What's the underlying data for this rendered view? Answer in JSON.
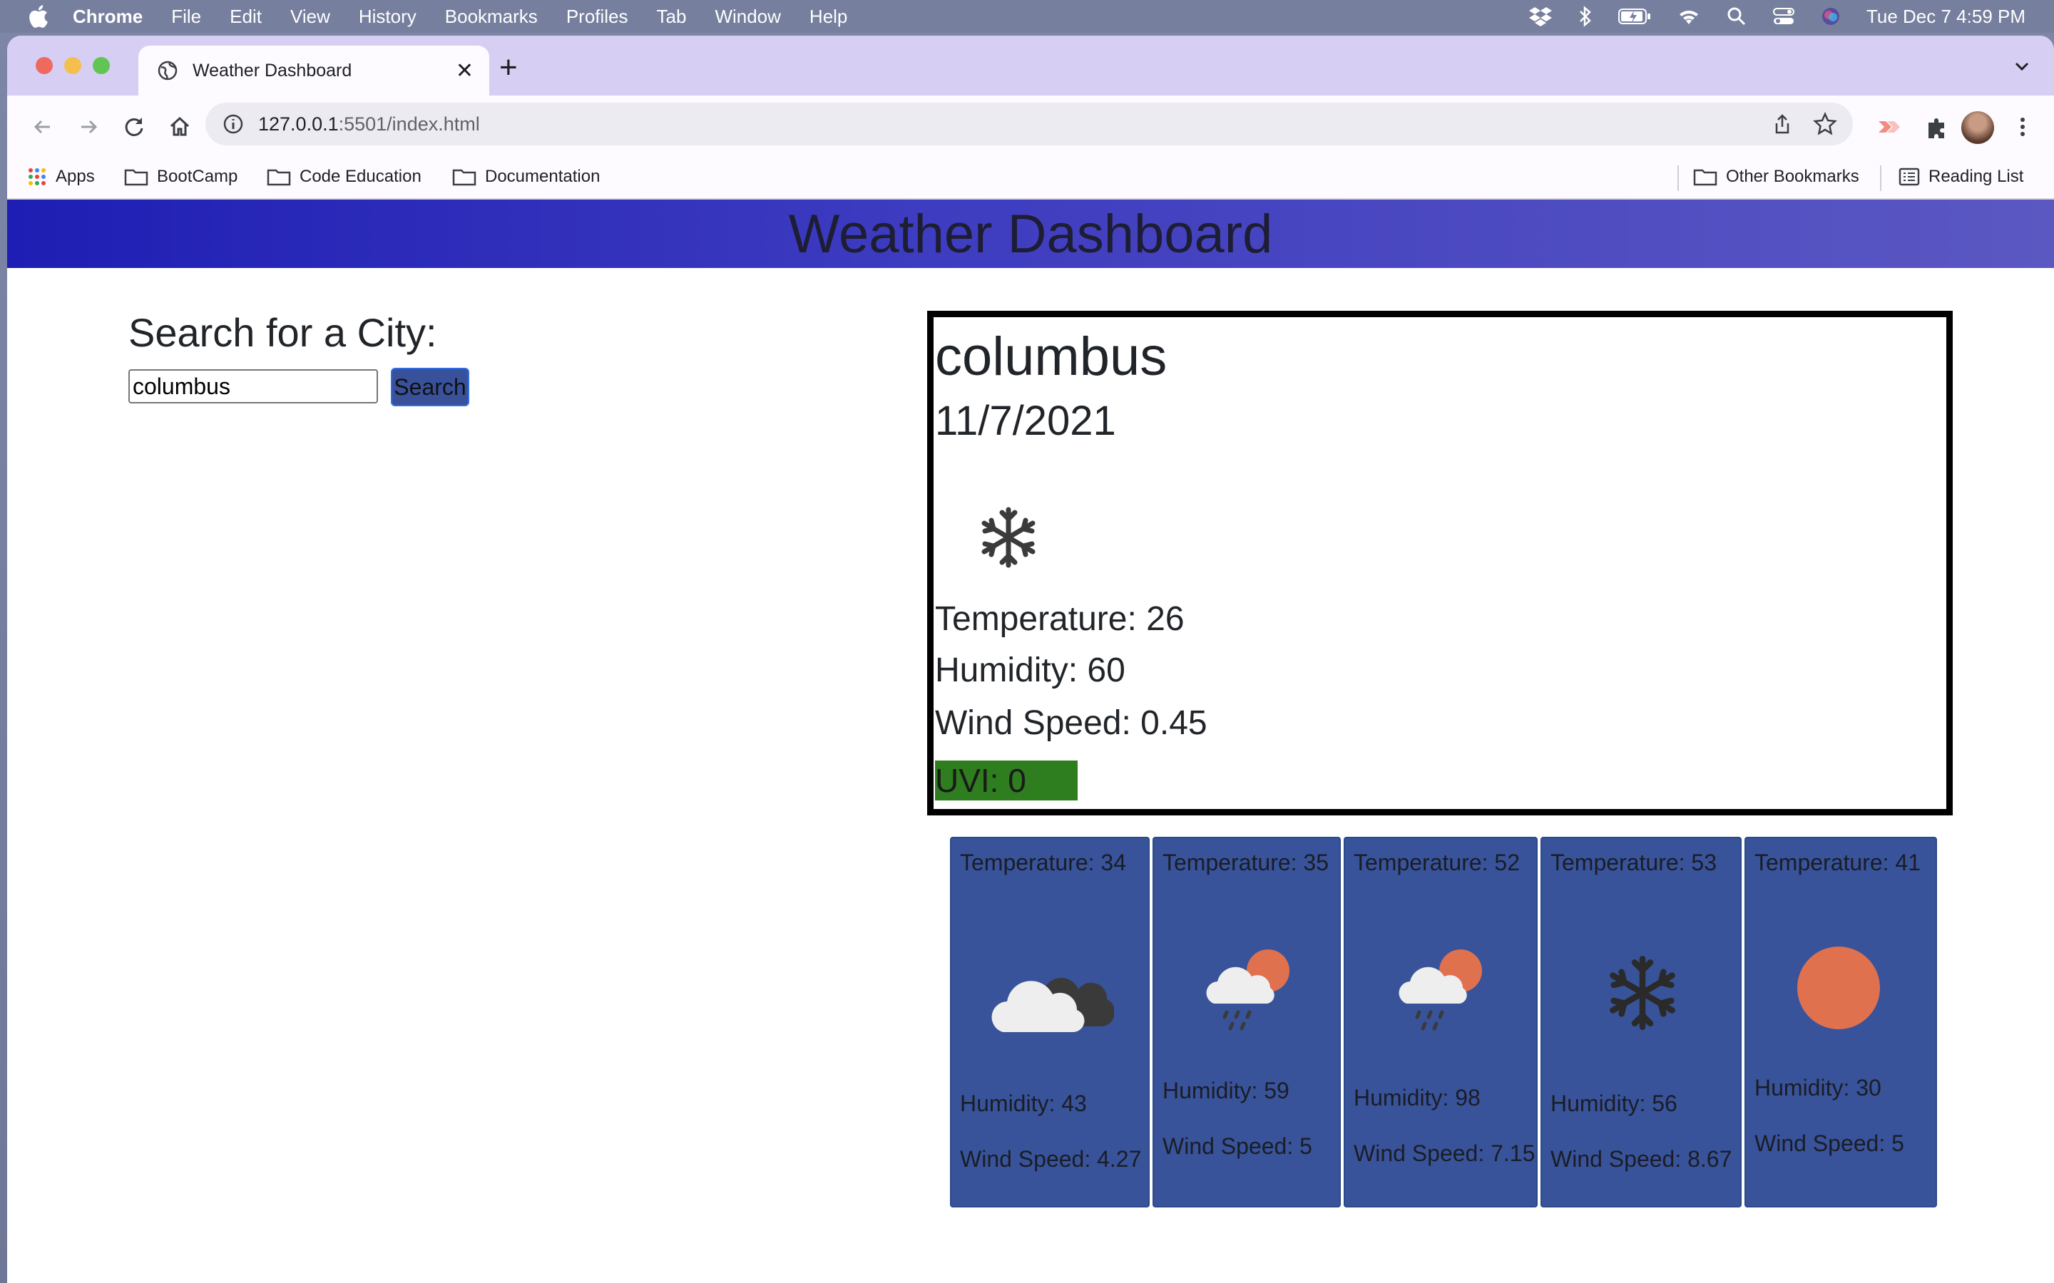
{
  "menubar": {
    "app_name": "Chrome",
    "items": [
      "File",
      "Edit",
      "View",
      "History",
      "Bookmarks",
      "Profiles",
      "Tab",
      "Window",
      "Help"
    ],
    "clock": "Tue Dec 7  4:59 PM"
  },
  "browser": {
    "tab_title": "Weather Dashboard",
    "url_host": "127.0.0.1",
    "url_rest": ":5501/index.html",
    "bookmarks": [
      "Apps",
      "BootCamp",
      "Code Education",
      "Documentation"
    ],
    "other_bookmarks": "Other Bookmarks",
    "reading_list": "Reading List"
  },
  "page": {
    "title": "Weather Dashboard",
    "search_label": "Search for a City:",
    "search_value": "columbus",
    "search_button": "Search"
  },
  "current": {
    "city": "columbus",
    "date": "11/7/2021",
    "icon": "snowflake-icon",
    "temperature": "Temperature: 26",
    "humidity": "Humidity: 60",
    "wind": "Wind Speed: 0.45",
    "uvi": "UVI: 0",
    "uvi_color": "#2e7d1f"
  },
  "forecast": [
    {
      "temp": "Temperature: 34",
      "icon": "cloudy-icon",
      "humidity": "Humidity: 43",
      "wind": "Wind Speed: 4.27"
    },
    {
      "temp": "Temperature: 35",
      "icon": "rain-sun-icon",
      "humidity": "Humidity: 59",
      "wind": "Wind Speed: 5"
    },
    {
      "temp": "Temperature: 52",
      "icon": "rain-sun-icon",
      "humidity": "Humidity: 98",
      "wind": "Wind Speed: 7.15"
    },
    {
      "temp": "Temperature: 53",
      "icon": "snowflake-icon",
      "humidity": "Humidity: 56",
      "wind": "Wind Speed: 8.67"
    },
    {
      "temp": "Temperature: 41",
      "icon": "sun-icon",
      "humidity": "Humidity: 30",
      "wind": "Wind Speed: 5"
    }
  ],
  "colors": {
    "header_gradient_start": "#1e1eb4",
    "header_gradient_end": "#5b58c2",
    "card_bg": "#38539a",
    "sun": "#e0714f"
  }
}
